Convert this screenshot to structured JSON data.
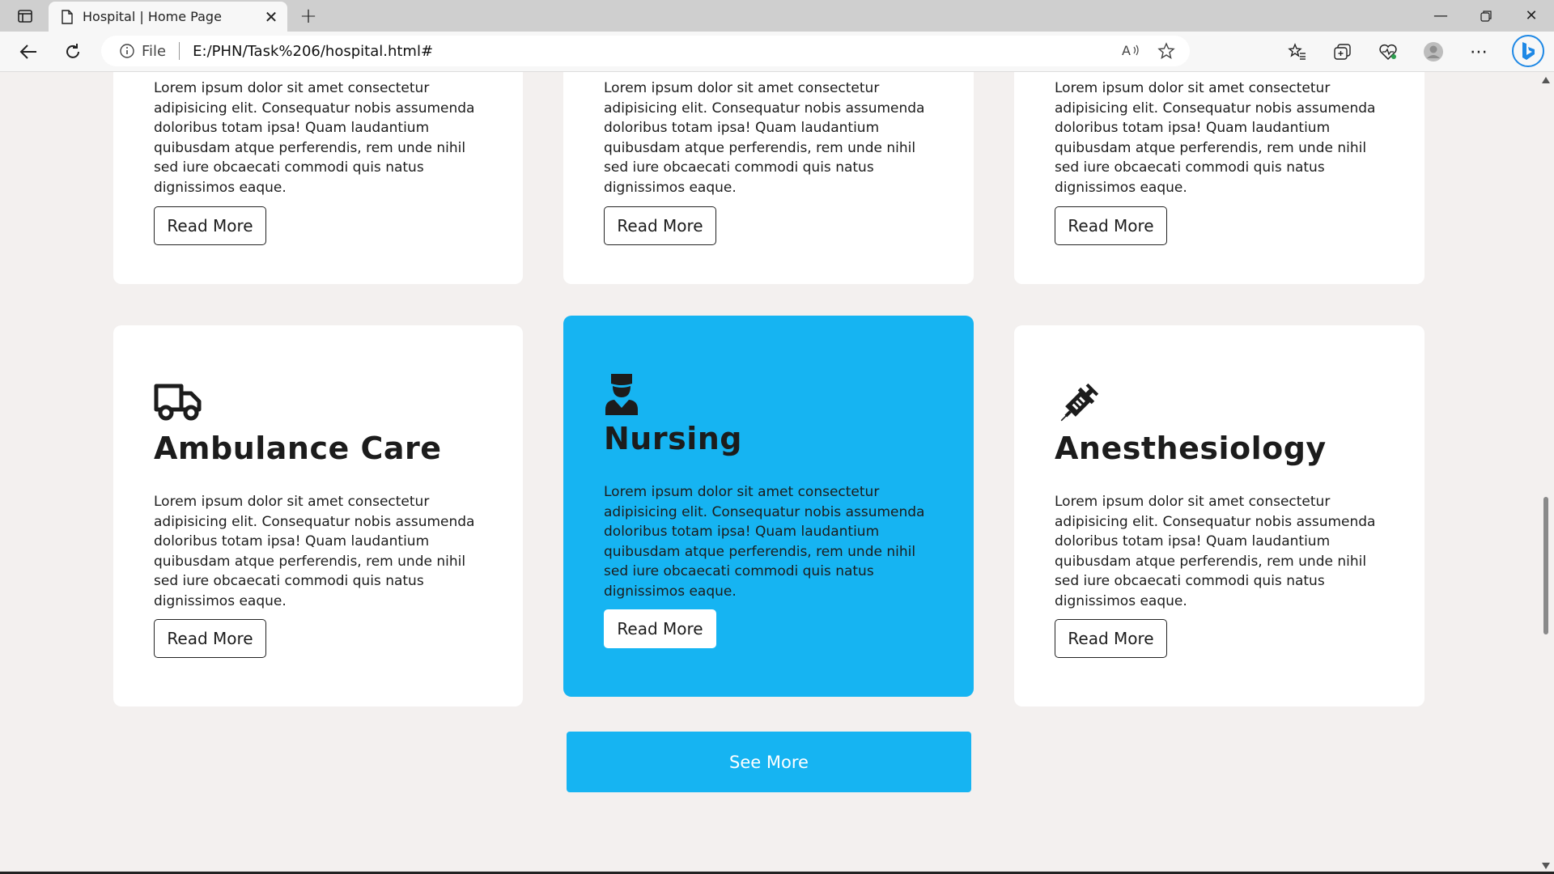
{
  "browser": {
    "tab_title": "Hospital | Home Page",
    "address_label": "File",
    "url": "E:/PHN/Task%206/hospital.html#"
  },
  "cards_top": [
    {
      "body": "Lorem ipsum dolor sit amet consectetur adipisicing elit. Consequatur nobis assumenda doloribus totam ipsa! Quam laudantium quibusdam atque perferendis, rem unde nihil sed iure obcaecati commodi quis natus dignissimos eaque.",
      "button": "Read More"
    },
    {
      "body": "Lorem ipsum dolor sit amet consectetur adipisicing elit. Consequatur nobis assumenda doloribus totam ipsa! Quam laudantium quibusdam atque perferendis, rem unde nihil sed iure obcaecati commodi quis natus dignissimos eaque.",
      "button": "Read More"
    },
    {
      "body": "Lorem ipsum dolor sit amet consectetur adipisicing elit. Consequatur nobis assumenda doloribus totam ipsa! Quam laudantium quibusdam atque perferendis, rem unde nihil sed iure obcaecati commodi quis natus dignissimos eaque.",
      "button": "Read More"
    }
  ],
  "cards": [
    {
      "icon": "truck-icon",
      "title": "Ambulance Care",
      "body": "Lorem ipsum dolor sit amet consectetur adipisicing elit. Consequatur nobis assumenda doloribus totam ipsa! Quam laudantium quibusdam atque perferendis, rem unde nihil sed iure obcaecati commodi quis natus dignissimos eaque.",
      "button": "Read More"
    },
    {
      "icon": "nurse-icon",
      "title": "Nursing",
      "body": "Lorem ipsum dolor sit amet consectetur adipisicing elit. Consequatur nobis assumenda doloribus totam ipsa! Quam laudantium quibusdam atque perferendis, rem unde nihil sed iure obcaecati commodi quis natus dignissimos eaque.",
      "button": "Read More",
      "highlighted": true
    },
    {
      "icon": "syringe-icon",
      "title": "Anesthesiology",
      "body": "Lorem ipsum dolor sit amet consectetur adipisicing elit. Consequatur nobis assumenda doloribus totam ipsa! Quam laudantium quibusdam atque perferendis, rem unde nihil sed iure obcaecati commodi quis natus dignissimos eaque.",
      "button": "Read More"
    }
  ],
  "see_more": "See More",
  "colors": {
    "accent": "#16b4f2",
    "card": "#ffffff",
    "page_bg": "#f3f0ef",
    "text": "#1c1c1c"
  }
}
